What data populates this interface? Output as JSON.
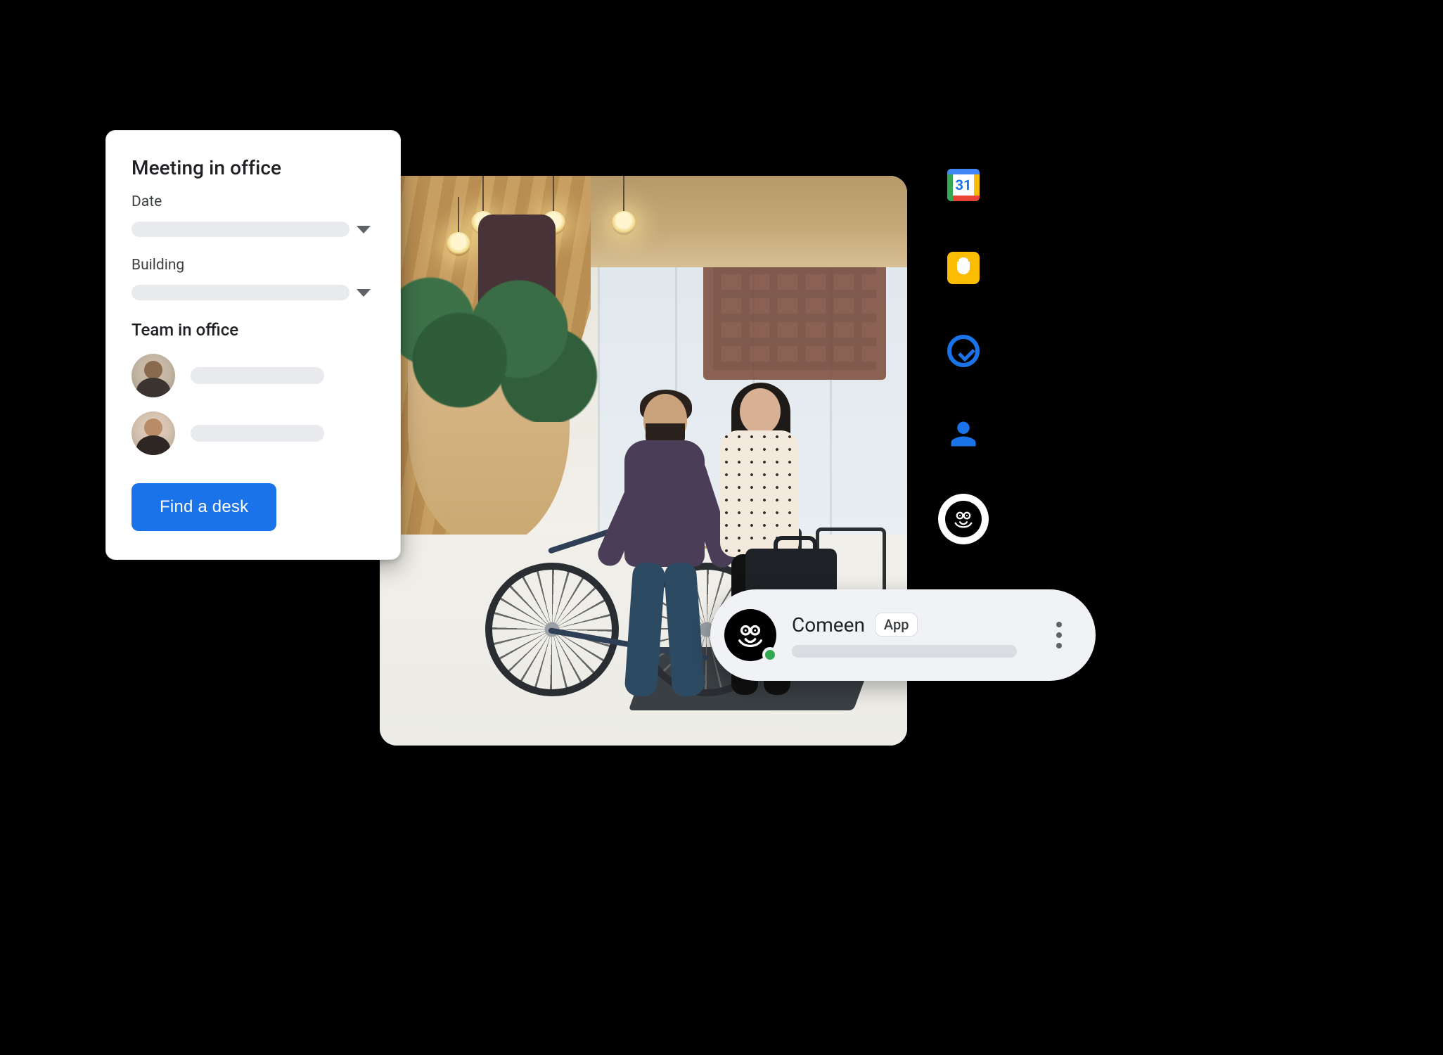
{
  "card": {
    "title": "Meeting in office",
    "date_label": "Date",
    "building_label": "Building",
    "team_heading": "Team in office",
    "cta_label": "Find a desk"
  },
  "side_rail": {
    "calendar_day": "31"
  },
  "chat": {
    "app_name": "Comeen",
    "badge": "App"
  }
}
